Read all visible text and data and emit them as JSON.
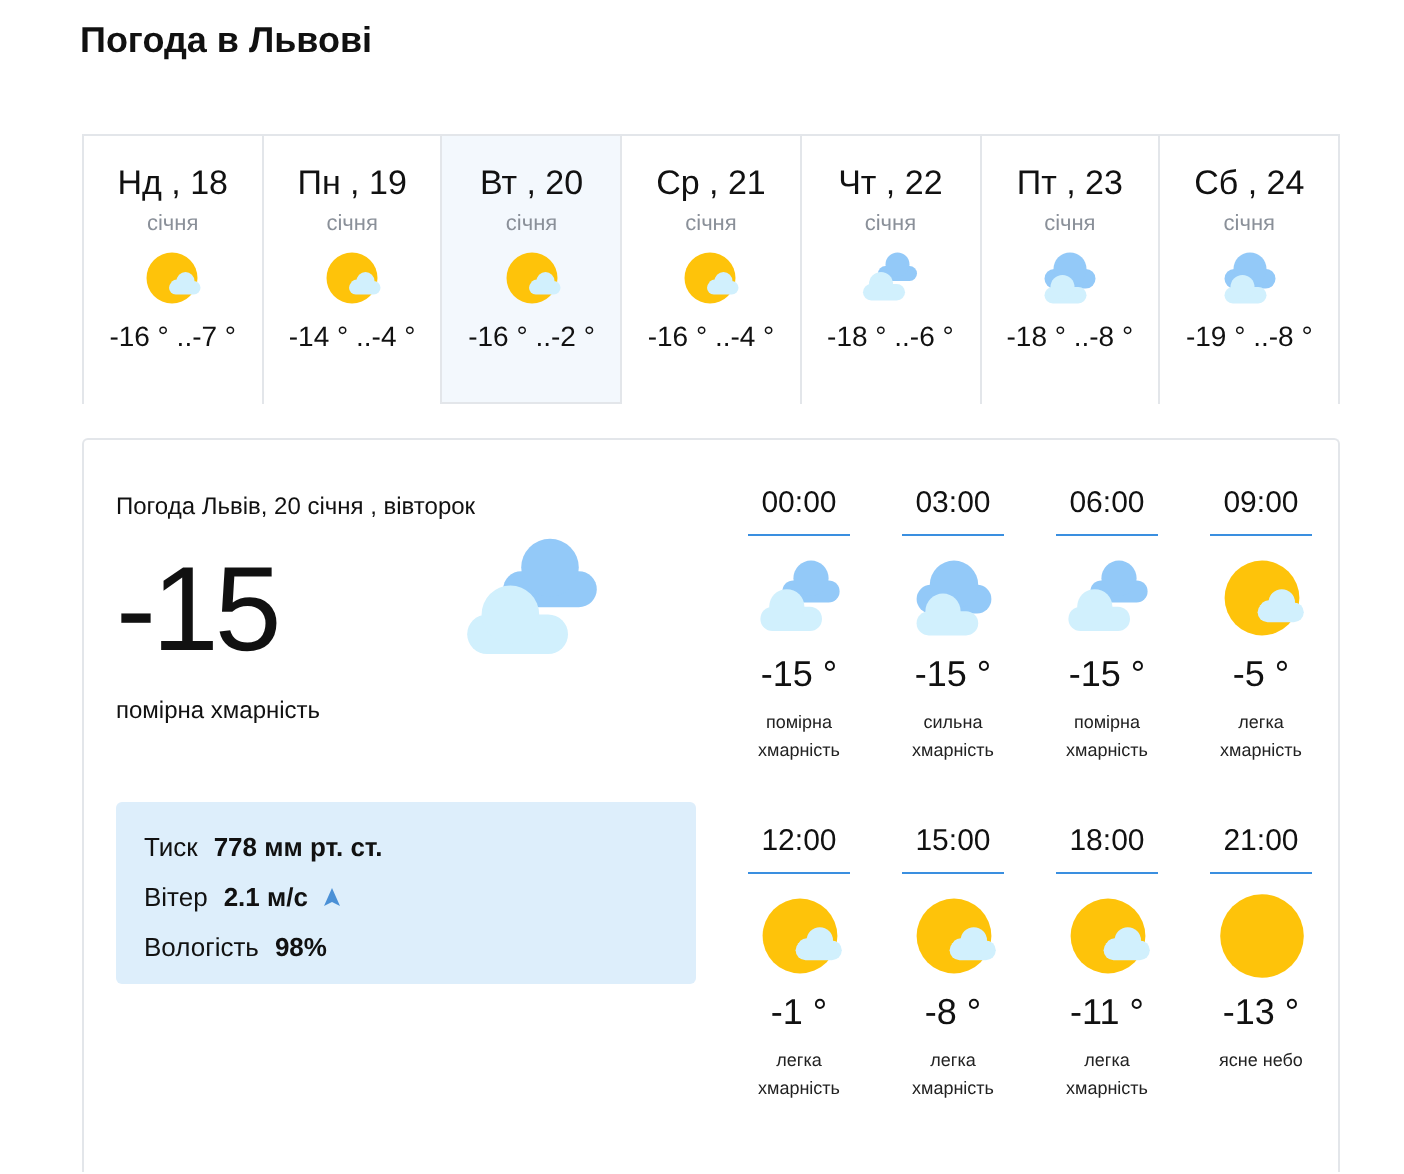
{
  "title": "Погода в Львові",
  "days": [
    {
      "day": "Нд , 18",
      "month": "січня",
      "kind": "sun-cloud",
      "temps": "-16 ° ..-7 °",
      "selected": false
    },
    {
      "day": "Пн , 19",
      "month": "січня",
      "kind": "sun-cloud",
      "temps": "-14 ° ..-4 °",
      "selected": false
    },
    {
      "day": "Вт , 20",
      "month": "січня",
      "kind": "sun-cloud",
      "temps": "-16 ° ..-2 °",
      "selected": true
    },
    {
      "day": "Ср , 21",
      "month": "січня",
      "kind": "sun-cloud",
      "temps": "-16 ° ..-4 °",
      "selected": false
    },
    {
      "day": "Чт , 22",
      "month": "січня",
      "kind": "clouds",
      "temps": "-18 ° ..-6 °",
      "selected": false
    },
    {
      "day": "Пт , 23",
      "month": "січня",
      "kind": "overcast",
      "temps": "-18 ° ..-8 °",
      "selected": false
    },
    {
      "day": "Сб , 24",
      "month": "січня",
      "kind": "overcast",
      "temps": "-19 ° ..-8 °",
      "selected": false
    }
  ],
  "current": {
    "heading": "Погода Львів, 20 січня , вівторок",
    "temperature": "-15",
    "kind": "clouds",
    "description": "помірна хмарність",
    "details": [
      {
        "label": "Тиск",
        "value": "778 мм рт. ст.",
        "kind": "plain"
      },
      {
        "label": "Вітер",
        "value": "2.1 м/с",
        "kind": "wind"
      },
      {
        "label": "Вологість",
        "value": "98%",
        "kind": "plain"
      }
    ]
  },
  "hours": [
    {
      "time": "00:00",
      "kind": "clouds",
      "temp": "-15 °",
      "description": "помірна хмарність"
    },
    {
      "time": "03:00",
      "kind": "overcast",
      "temp": "-15 °",
      "description": "сильна хмарність"
    },
    {
      "time": "06:00",
      "kind": "clouds",
      "temp": "-15 °",
      "description": "помірна хмарність"
    },
    {
      "time": "09:00",
      "kind": "sun-cloud",
      "temp": "-5 °",
      "description": "легка хмарність"
    },
    {
      "time": "12:00",
      "kind": "sun-cloud",
      "temp": "-1 °",
      "description": "легка хмарність"
    },
    {
      "time": "15:00",
      "kind": "sun-cloud",
      "temp": "-8 °",
      "description": "легка хмарність"
    },
    {
      "time": "18:00",
      "kind": "sun-cloud",
      "temp": "-11 °",
      "description": "легка хмарність"
    },
    {
      "time": "21:00",
      "kind": "sun",
      "temp": "-13 °",
      "description": "ясне небо"
    }
  ]
}
